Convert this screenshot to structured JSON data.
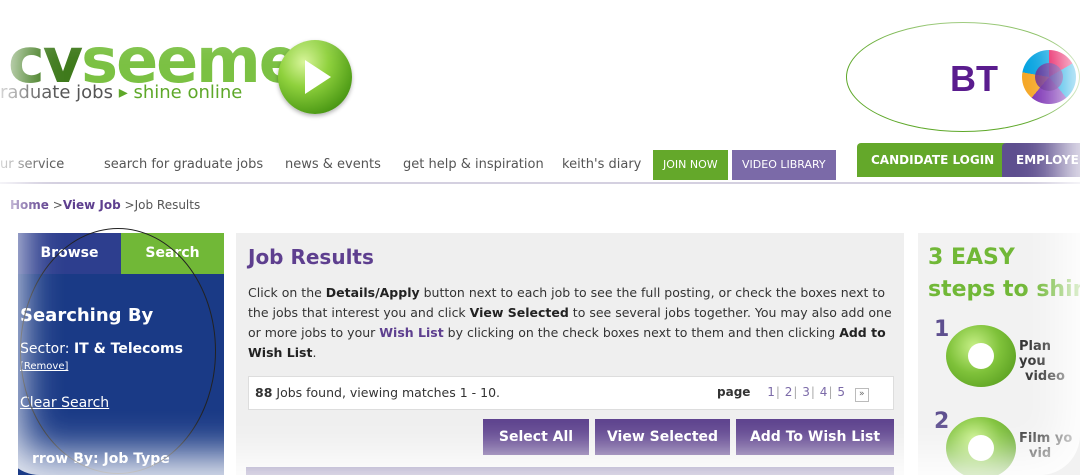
{
  "header": {
    "logo_prefix": "cv",
    "logo_word": "seeme",
    "tagline_left": "raduate jobs",
    "tagline_arrow": "▸",
    "tagline_right": "shine online",
    "bt_text": "BT"
  },
  "nav": {
    "items": [
      "ur service",
      "search for graduate jobs",
      "news & events",
      "get help & inspiration",
      "keith's diary"
    ],
    "join_now": "JOIN NOW",
    "video_library": "VIDEO LIBRARY",
    "candidate_login": "CANDIDATE LOGIN",
    "employer": "EMPLOYE"
  },
  "breadcrumb": {
    "home": "Home",
    "sep1": " >",
    "view_job": "View Job",
    "sep2": " >",
    "current": "Job Results"
  },
  "sidebar": {
    "tab_browse": "Browse",
    "tab_search": "Search",
    "title": "Searching By",
    "sector_label": "Sector:",
    "sector_value": "IT & Telecoms",
    "remove": "[Remove]",
    "clear": "Clear Search",
    "narrow": "rrow By: Job Type"
  },
  "main": {
    "title": "Job Results",
    "desc": {
      "p1": "Click on the ",
      "b1": "Details/Apply",
      "p2": " button next to each job to see the full posting, or check the boxes next to the jobs that interest you and click ",
      "b2": "View Selected",
      "p3": " to see several jobs together. You may also add one or more jobs to your ",
      "l1": "Wish List",
      "p4": " by clicking on the check boxes next to them and then clicking ",
      "b3": "Add to Wish List",
      "p5": "."
    },
    "results_count": "88",
    "results_text": " Jobs found, viewing matches 1 - 10.",
    "page_label": "page",
    "pages": [
      "1",
      "2",
      "3",
      "4",
      "5"
    ],
    "next": "»",
    "buttons": {
      "select_all": "Select All",
      "view_selected": "View Selected",
      "add_wish": "Add To Wish List"
    }
  },
  "right": {
    "title_line1": "3 EASY",
    "title_line2": "steps to shin",
    "step1_num": "1",
    "step1_text_a": "Plan you",
    "step1_text_b": "video",
    "step2_num": "2",
    "step2_text_a": "Film yo",
    "step2_text_b": "vid"
  },
  "colors": {
    "brand_green": "#71b837",
    "brand_purple": "#5b3f8c",
    "sidebar_blue": "#1a3a86"
  }
}
